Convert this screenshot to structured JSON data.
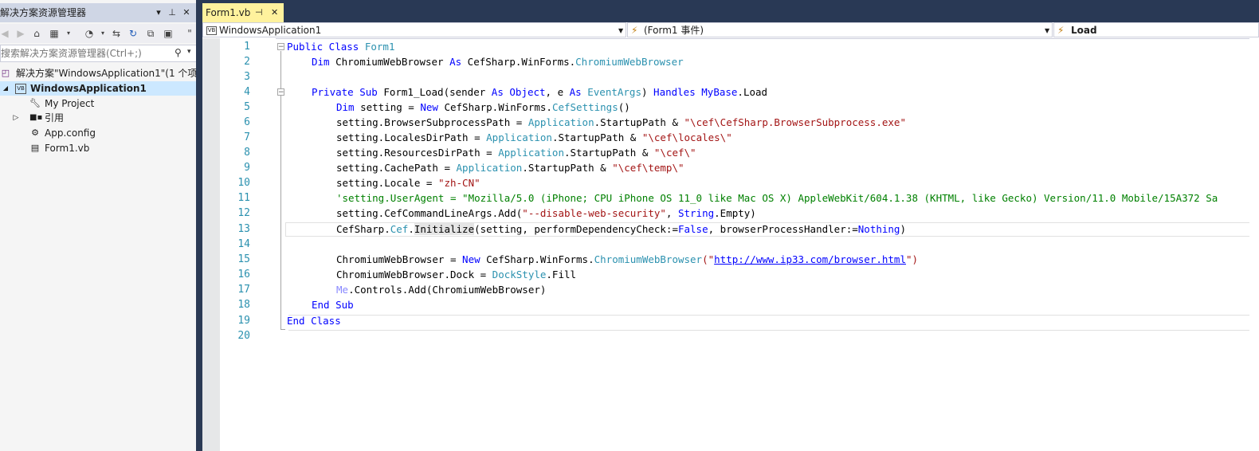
{
  "solution_explorer": {
    "title": "解决方案资源管理器",
    "title_buttons": {
      "dropdown": "▾",
      "pin": "⊥",
      "close": "✕"
    },
    "search_placeholder": "搜索解决方案资源管理器(Ctrl+;)",
    "tree": [
      {
        "label": "解决方案\"WindowsApplication1\"(1 个项目)",
        "icon": "solution-icon",
        "selected": false
      },
      {
        "label": "WindowsApplication1",
        "icon": "vb-project-icon",
        "selected": true
      },
      {
        "label": "My Project",
        "icon": "wrench-icon",
        "selected": false
      },
      {
        "label": "引用",
        "icon": "references-icon",
        "selected": false
      },
      {
        "label": "App.config",
        "icon": "config-file-icon",
        "selected": false
      },
      {
        "label": "Form1.vb",
        "icon": "form-file-icon",
        "selected": false
      }
    ]
  },
  "editor": {
    "tab": {
      "label": "Form1.vb",
      "pin": "⊣",
      "close": "✕"
    },
    "nav": {
      "project": "WindowsApplication1",
      "object": "(Form1 事件)",
      "member": "Load"
    },
    "line_numbers": [
      "1",
      "2",
      "3",
      "4",
      "5",
      "6",
      "7",
      "8",
      "9",
      "10",
      "11",
      "12",
      "13",
      "14",
      "15",
      "16",
      "17",
      "18",
      "19",
      "20"
    ]
  },
  "colors": {
    "tab_active": "#fff29d",
    "chrome_dark": "#293955",
    "keyword": "#0000ff",
    "type": "#2b91af",
    "string": "#a31515",
    "comment": "#008000",
    "selection": "#cce8ff"
  },
  "code": {
    "l1": {
      "a": "Public Class ",
      "b": "Form1"
    },
    "l2": {
      "a": "Dim",
      "b": " ChromiumWebBrowser ",
      "c": "As",
      "d": " CefSharp.WinForms.",
      "e": "ChromiumWebBrowser"
    },
    "l4": {
      "a": "Private Sub",
      "b": " Form1_Load(sender ",
      "c": "As",
      "d": " ",
      "e": "Object",
      "f": ", e ",
      "g": "As",
      "h": " ",
      "i": "EventArgs",
      "j": ") ",
      "k": "Handles",
      "l": " ",
      "m": "MyBase",
      "n": ".Load"
    },
    "l5": {
      "a": "Dim",
      "b": " setting = ",
      "c": "New",
      "d": " CefSharp.WinForms.",
      "e": "CefSettings",
      "f": "()"
    },
    "l6": {
      "a": "setting.BrowserSubprocessPath = ",
      "b": "Application",
      "c": ".StartupPath & ",
      "d": "\"\\cef\\CefSharp.BrowserSubprocess.exe\""
    },
    "l7": {
      "a": "setting.LocalesDirPath = ",
      "b": "Application",
      "c": ".StartupPath & ",
      "d": "\"\\cef\\locales\\\""
    },
    "l8": {
      "a": "setting.ResourcesDirPath = ",
      "b": "Application",
      "c": ".StartupPath & ",
      "d": "\"\\cef\\\""
    },
    "l9": {
      "a": "setting.CachePath = ",
      "b": "Application",
      "c": ".StartupPath & ",
      "d": "\"\\cef\\temp\\\""
    },
    "l10": {
      "a": "setting.Locale = ",
      "b": "\"zh-CN\""
    },
    "l11": {
      "a": "'setting.UserAgent = \"Mozilla/5.0 (iPhone; CPU iPhone OS 11_0 like Mac OS X) AppleWebKit/604.1.38 (KHTML, like Gecko) Version/11.0 Mobile/15A372 Sa"
    },
    "l12": {
      "a": "setting.CefCommandLineArgs.Add(",
      "b": "\"--disable-web-security\"",
      "c": ", ",
      "d": "String",
      "e": ".Empty)"
    },
    "l13": {
      "a": "CefSharp.",
      "b": "Cef",
      "c": ".",
      "d": "Initialize",
      "e": "(setting, performDependencyCheck:=",
      "f": "False",
      "g": ", browserProcessHandler:=",
      "h": "Nothing",
      "i": ")"
    },
    "l15": {
      "a": "ChromiumWebBrowser = ",
      "b": "New",
      "c": " CefSharp.WinForms.",
      "d": "ChromiumWebBrowser",
      "e": "(\"",
      "f": "http://www.ip33.com/browser.html",
      "g": "\")"
    },
    "l16": {
      "a": "ChromiumWebBrowser.Dock = ",
      "b": "DockStyle",
      "c": ".Fill"
    },
    "l17": {
      "a": "Me",
      "b": ".Controls.Add(ChromiumWebBrowser)"
    },
    "l18": {
      "a": "End Sub"
    },
    "l19": {
      "a": "End Class"
    }
  }
}
